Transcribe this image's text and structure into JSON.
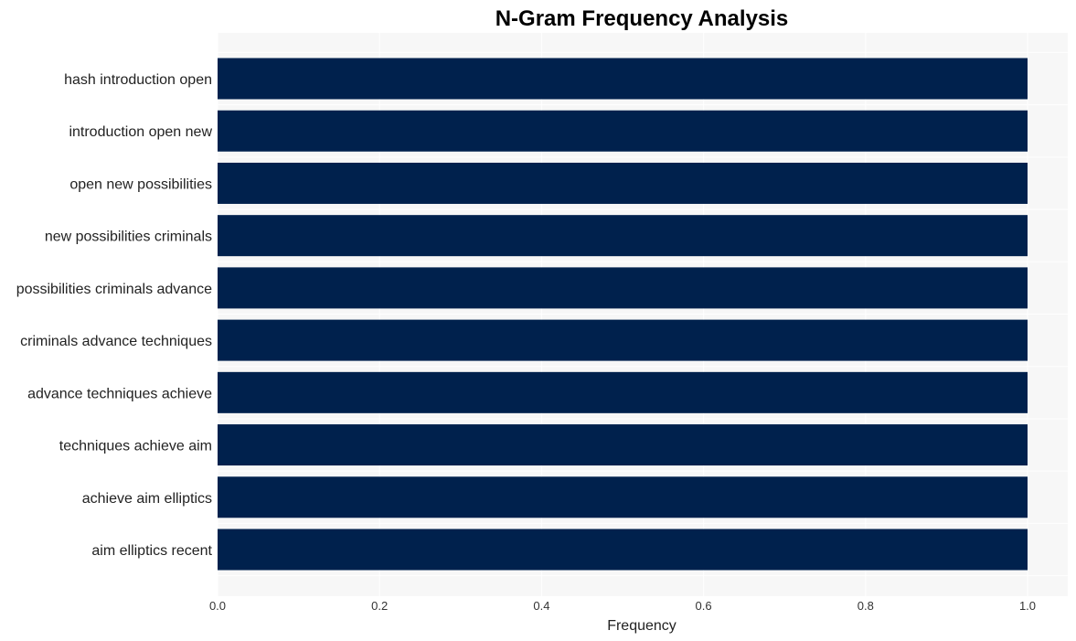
{
  "chart_data": {
    "type": "bar",
    "orientation": "horizontal",
    "title": "N-Gram Frequency Analysis",
    "xlabel": "Frequency",
    "ylabel": "",
    "categories": [
      "hash introduction open",
      "introduction open new",
      "open new possibilities",
      "new possibilities criminals",
      "possibilities criminals advance",
      "criminals advance techniques",
      "advance techniques achieve",
      "techniques achieve aim",
      "achieve aim elliptics",
      "aim elliptics recent"
    ],
    "values": [
      1,
      1,
      1,
      1,
      1,
      1,
      1,
      1,
      1,
      1
    ],
    "xlim": [
      0,
      1.05
    ],
    "xticks": [
      "0.0",
      "0.2",
      "0.4",
      "0.6",
      "0.8",
      "1.0"
    ],
    "xtick_values": [
      0,
      0.2,
      0.4,
      0.6,
      0.8,
      1.0
    ],
    "grid": true,
    "bar_color": "#00214d",
    "background_color": "#f7f7f7",
    "grid_color": "#ffffff"
  }
}
